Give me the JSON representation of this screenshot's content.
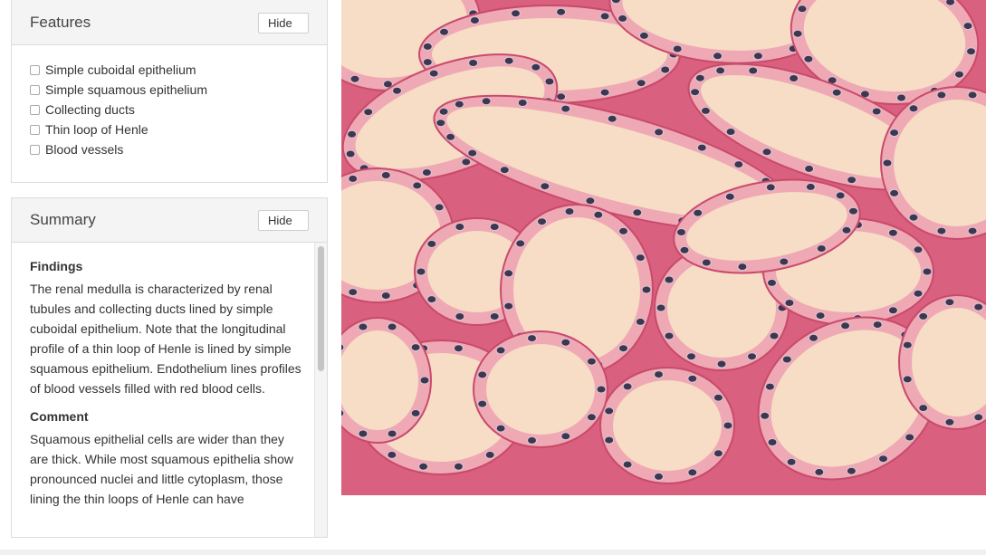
{
  "features": {
    "title": "Features",
    "hide_label": "Hide",
    "items": [
      {
        "label": "Simple cuboidal epithelium",
        "checked": false
      },
      {
        "label": "Simple squamous epithelium",
        "checked": false
      },
      {
        "label": "Collecting ducts",
        "checked": false
      },
      {
        "label": "Thin loop of Henle",
        "checked": false
      },
      {
        "label": "Blood vessels",
        "checked": false
      }
    ]
  },
  "summary": {
    "title": "Summary",
    "hide_label": "Hide",
    "findings_heading": "Findings",
    "findings_text": "The renal medulla is characterized by renal tubules and collecting ducts lined by simple cuboidal epithelium. Note that the longitudinal profile of a thin loop of Henle is lined by simple squamous epithelium. Endothelium lines profiles of blood vessels filled with red blood cells.",
    "comment_heading": "Comment",
    "comment_text": "Squamous epithelial cells are wider than they are thick. While most squamous epithelia show pronounced nuclei and little cytoplasm, those lining the thin loops of Henle can have"
  },
  "image": {
    "stain_colors": {
      "background": "#f3c6b6",
      "lumen": "#f7dcc6",
      "stroma": "#d9607e",
      "nucleus": "#3f3650"
    }
  }
}
